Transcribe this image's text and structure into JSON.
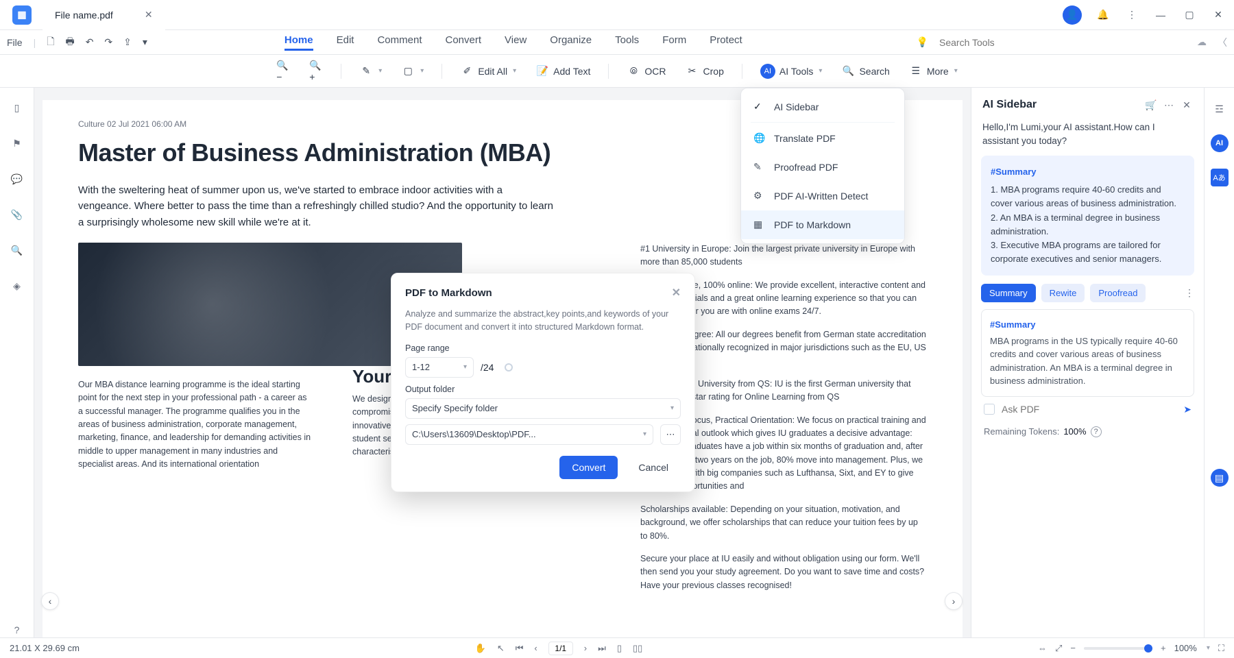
{
  "titlebar": {
    "filename": "File name.pdf"
  },
  "menubar": {
    "file": "File",
    "tabs": [
      "Home",
      "Edit",
      "Comment",
      "Convert",
      "View",
      "Organize",
      "Tools",
      "Form",
      "Protect"
    ],
    "activeTab": "Home",
    "searchPlaceholder": "Search Tools"
  },
  "toolbar": {
    "edit_all": "Edit All",
    "add_text": "Add Text",
    "ocr": "OCR",
    "crop": "Crop",
    "ai_tools": "AI Tools",
    "search": "Search",
    "more": "More"
  },
  "doc": {
    "meta": "Culture 02 Jul 2021 06:00 AM",
    "h1": "Master of Business Administration (MBA)",
    "intro": "With the sweltering heat of summer upon us, we've started to embrace indoor activities with a vengeance. Where better to pass the time than a refreshingly chilled studio? And the opportunity to learn a surprisingly wholesome new skill while we're at it.",
    "colA": "Our MBA distance learning programme is the ideal starting point for the next step in your professional path - a career as a successful manager. The programme qualifies you in the areas of business administration, corporate management, marketing, finance, and leadership for demanding activities in middle to upper management in many industries and specialist areas. And its international orientation",
    "colB_h2": "Your de",
    "colB": "We design our programmes to be flexible and innovative without compromising on quality. We deliver specialist expertise and innovative learning materials as well as focusing on excellent student services and professional advice. Our programmes are characterised by the effective",
    "colC1": "#1 University in Europe: Join the largest private university in Europe with more than 85,000 students",
    "colC2": "Digital, Flexible, 100% online: We provide excellent, interactive content and learning materials and a great online learning experience so that you can study wherever you are with online exams 24/7.",
    "colC3": "Accredited Degree: All our degrees benefit from German state accreditation and are internationally recognized in major jurisdictions such as the EU, US and",
    "colC4": "Five-star rated University from QS: IU is the first German university that achieved a 5-star rating for Online Learning from QS",
    "colC5": "International focus, Practical Orientation: We focus on practical training and an international outlook which gives IU graduates a decisive advantage: 94% of our graduates have a job within six months of graduation and, after an average of two years on the job, 80% move into management. Plus, we work closely with big companies such as Lufthansa, Sixt, and EY to give you great opportunities and",
    "colC6": "Scholarships available: Depending on your situation, motivation, and background, we offer scholarships that can reduce your tuition fees by up to 80%.",
    "colC7": "Secure your place at IU easily and without obligation using our form. We'll then send you your study agreement. Do you want to save time and costs? Have your previous classes recognised!"
  },
  "dropdown": {
    "items": [
      "AI Sidebar",
      "Translate PDF",
      "Proofread PDF",
      "PDF AI-Written Detect",
      "PDF to Markdown"
    ]
  },
  "modal": {
    "title": "PDF to Markdown",
    "desc": "Analyze and summarize the abstract,key points,and keywords of your PDF document and convert it into structured Markdown format.",
    "page_range_label": "Page range",
    "range_value": "1-12",
    "total_pages": "/24",
    "output_label": "Output folder",
    "output_select": "Specify Specify folder",
    "output_path": "C:\\Users\\13609\\Desktop\\PDF...",
    "convert": "Convert",
    "cancel": "Cancel"
  },
  "ai": {
    "title": "AI Sidebar",
    "hello": "Hello,I'm Lumi,your AI assistant.How can I assistant you today?",
    "summary_tag": "#Summary",
    "s1": "1. MBA programs require 40-60 credits and cover various areas of business administration.",
    "s2": "2. An MBA is a terminal degree in business administration.",
    "s3": "3. Executive MBA programs are tailored for corporate executives and senior managers.",
    "chips": [
      "Summary",
      "Rewite",
      "Proofread"
    ],
    "card2_tag": "#Summary",
    "card2": "MBA programs in the US typically require 40-60 credits and cover various areas of business administration. An MBA is a terminal degree in business administration.",
    "ask_placeholder": "Ask PDF",
    "tokens_label": "Remaining Tokens:",
    "tokens_pct": "100%"
  },
  "status": {
    "dim": "21.01 X 29.69 cm",
    "page": "1/1",
    "zoom": "100%"
  }
}
